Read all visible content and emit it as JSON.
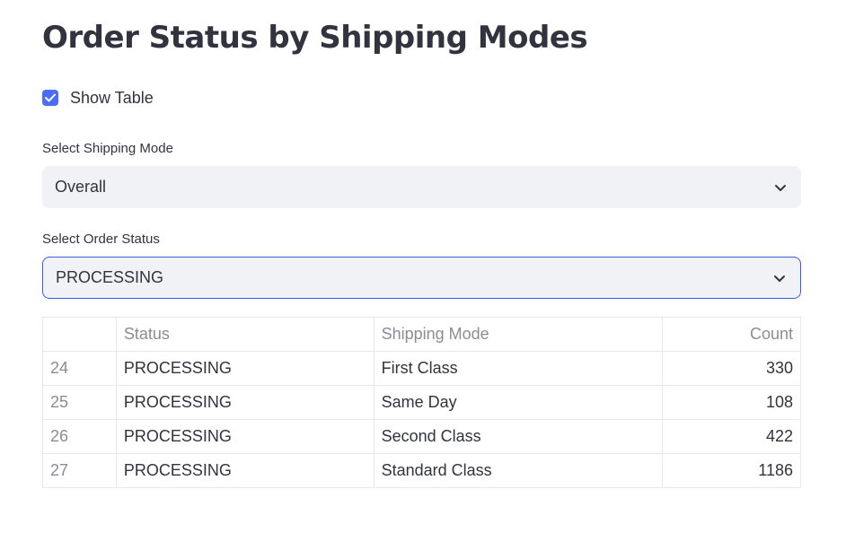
{
  "page": {
    "title": "Order Status by Shipping Modes"
  },
  "show_table": {
    "label": "Show Table",
    "checked": true
  },
  "shipping_mode": {
    "label": "Select Shipping Mode",
    "value": "Overall"
  },
  "order_status": {
    "label": "Select Order Status",
    "value": "PROCESSING"
  },
  "table": {
    "columns": [
      "",
      "Status",
      "Shipping Mode",
      "Count"
    ],
    "rows": [
      {
        "index": "24",
        "status": "PROCESSING",
        "mode": "First Class",
        "count": "330"
      },
      {
        "index": "25",
        "status": "PROCESSING",
        "mode": "Same Day",
        "count": "108"
      },
      {
        "index": "26",
        "status": "PROCESSING",
        "mode": "Second Class",
        "count": "422"
      },
      {
        "index": "27",
        "status": "PROCESSING",
        "mode": "Standard Class",
        "count": "1186"
      }
    ]
  },
  "colors": {
    "accent": "#4a6cf7",
    "focus_border": "#3b5bdb",
    "select_bg": "#f0f2f6",
    "text": "#31333f"
  }
}
